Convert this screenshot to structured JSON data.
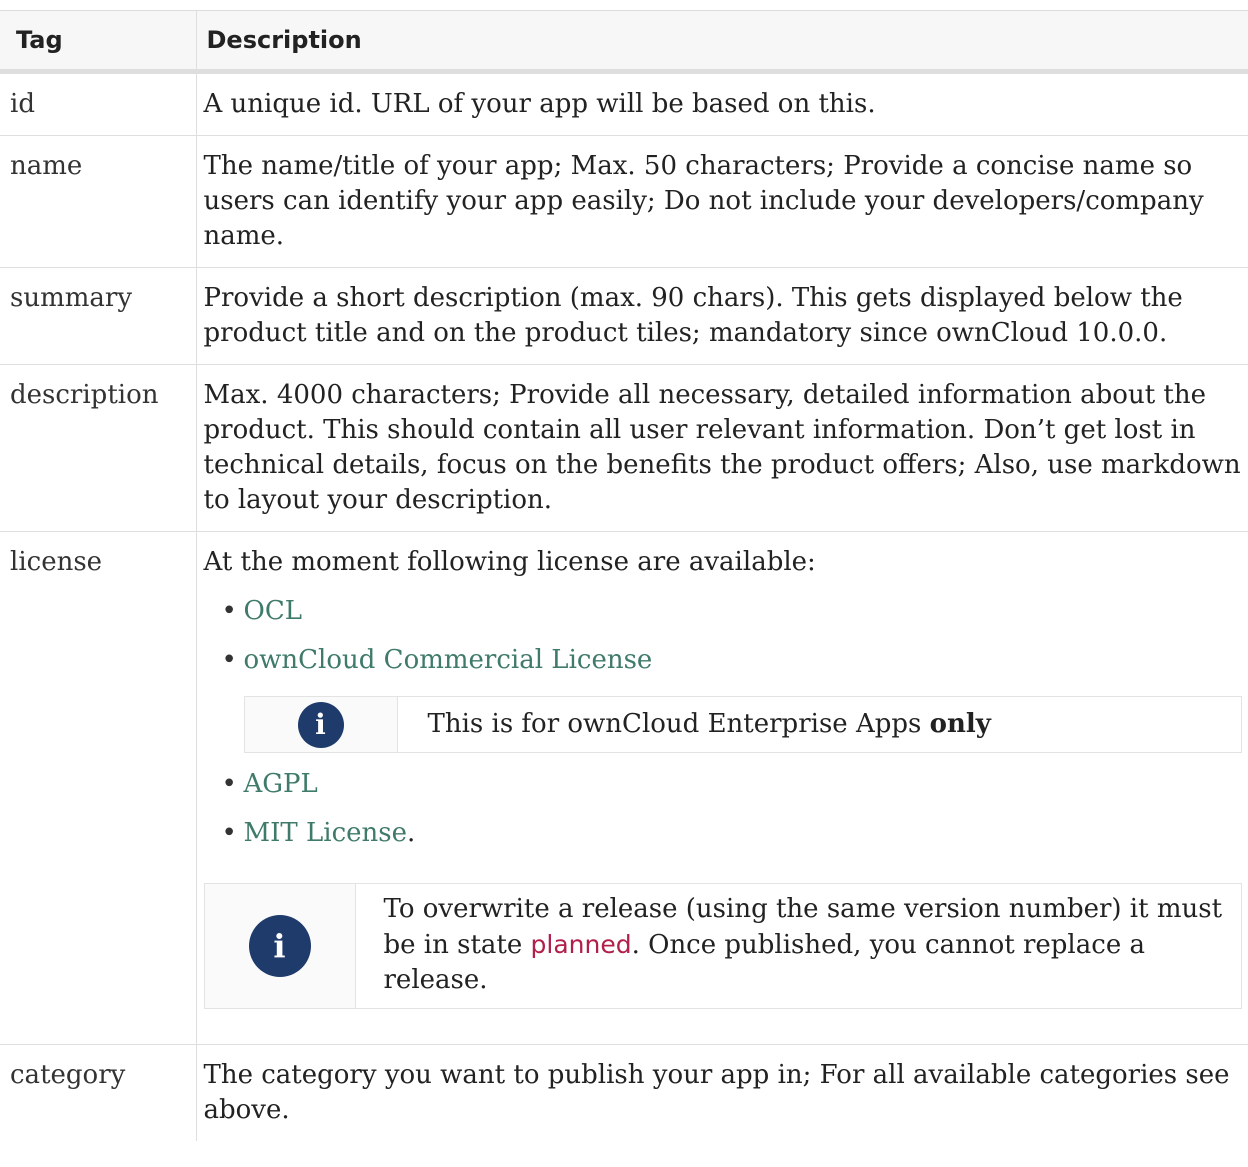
{
  "headers": {
    "tag": "Tag",
    "description": "Description"
  },
  "rows": [
    {
      "tag": "id",
      "description": "A unique id. URL of your app will be based on this."
    },
    {
      "tag": "name",
      "description": "The name/title of your app; Max. 50 characters; Provide a concise name so users can identify your app easily; Do not include your developers/company name."
    },
    {
      "tag": "summary",
      "description": "Provide a short description (max. 90 chars). This gets displayed below the product title and on the product tiles; mandatory since ownCloud 10.0.0."
    },
    {
      "tag": "description",
      "description": "Max. 4000 characters; Provide all necessary, detailed information about the product. This should contain all user relevant information. Don’t get lost in technical details, focus on the benefits the product offers; Also, use markdown to layout your description."
    },
    {
      "tag": "license",
      "description": "At the moment following license are available:"
    },
    {
      "tag": "category",
      "description": "The category you want to publish your app in; For all available categories see above."
    }
  ],
  "licenses": [
    {
      "label": "OCL"
    },
    {
      "label": "ownCloud Commercial License"
    },
    {
      "label": "AGPL"
    },
    {
      "label": "MIT License",
      "suffix": "."
    }
  ],
  "enterprise_note": {
    "text": "This is for ownCloud Enterprise Apps ",
    "emphasis": "only"
  },
  "release_note": {
    "before": "To overwrite a release (using the same version number) it must be in state ",
    "code": "planned",
    "after": ". Once published, you cannot replace a release."
  },
  "icon_glyph": "i",
  "icons": [
    "info-icon"
  ],
  "colors": {
    "link": "#3f7a6a",
    "code": "#b0204a",
    "info_icon": "#1f3b6b"
  }
}
